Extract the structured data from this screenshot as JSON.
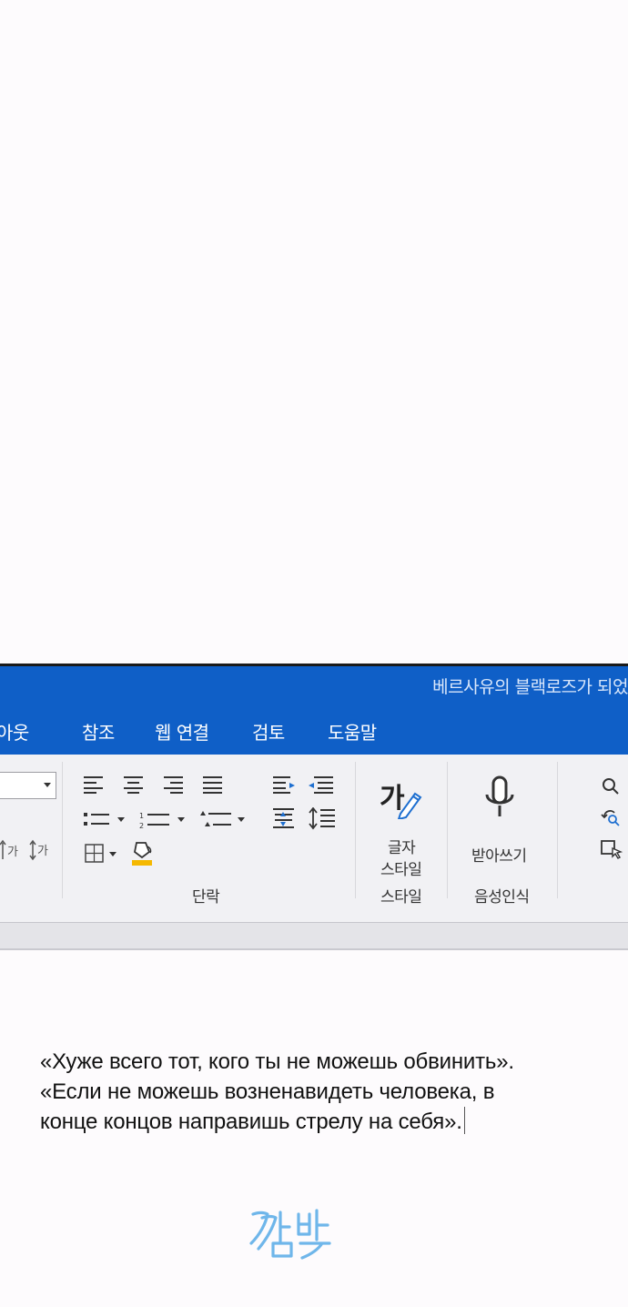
{
  "window": {
    "title": "베르사유의 블랙로즈가 되었",
    "menu": [
      "아웃",
      "참조",
      "웹 연결",
      "검토",
      "도움말"
    ]
  },
  "ribbon": {
    "groups": {
      "paragraph": "단락",
      "style": "스타일",
      "voice": "음성인식"
    },
    "buttons": {
      "char_style_line1": "글자",
      "char_style_line2": "스타일",
      "dictate": "받아쓰기"
    },
    "icons": {
      "char_style": "가",
      "font_small_left": "가",
      "font_small_right": "가"
    }
  },
  "quote": {
    "line1": "«Хуже всего тот, кого ты не можешь обвинить».",
    "line2": "«Если не можешь возненавидеть человека, в",
    "line3": "конце концов направишь стрелу на себя»."
  },
  "signature": "깜빡",
  "colors": {
    "titlebar": "#0f5fc7",
    "ribbon": "#f1f1f4",
    "highlight": "#f5b800",
    "signature": "#6fb6ea"
  }
}
